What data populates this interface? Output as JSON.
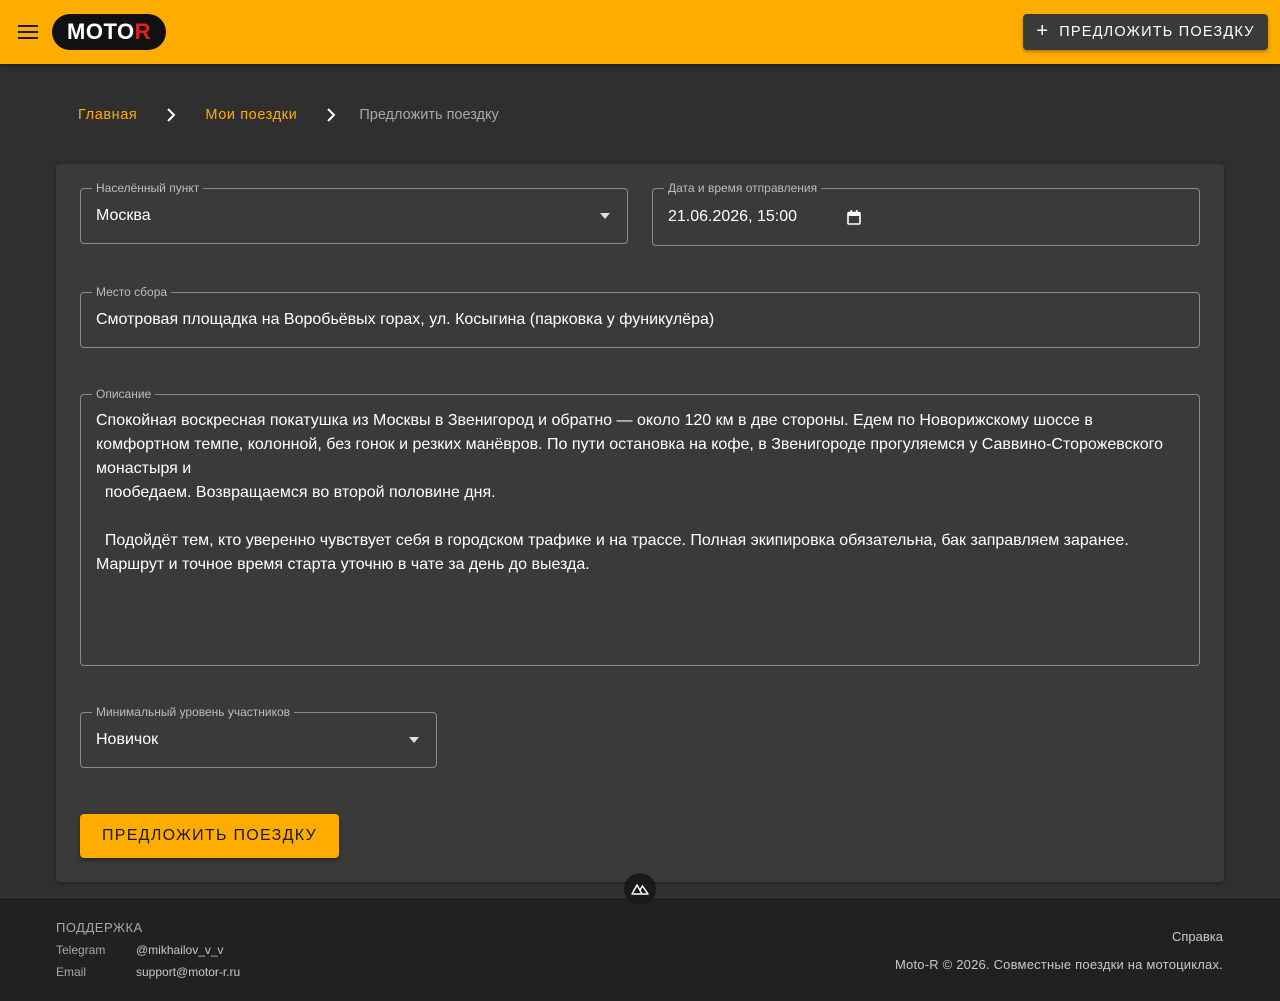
{
  "header": {
    "logo_main": "MOTO",
    "logo_accent": "R",
    "cta_label": "Предложить поездку"
  },
  "breadcrumb": {
    "items": [
      "Главная",
      "Мои поездки"
    ],
    "current": "Предложить поездку"
  },
  "form": {
    "city": {
      "label": "Населённый пункт",
      "value": "Москва"
    },
    "datetime": {
      "label": "Дата и время отправления",
      "value": "21.06.2026, 15:00"
    },
    "meeting_point": {
      "label": "Место сбора",
      "value": "Смотровая площадка на Воробьёвых горах, ул. Косыгина (парковка у фуникулёра)"
    },
    "description": {
      "label": "Описание",
      "value": "Спокойная воскресная покатушка из Москвы в Звенигород и обратно — около 120 км в две стороны. Едем по Новорижскому шоссе в комфортном темпе, колонной, без гонок и резких манёвров. По пути остановка на кофе, в Звенигороде прогуляемся у Саввино-Сторожевского монастыря и\n  пообедаем. Возвращаемся во второй половине дня.\n\n  Подойдёт тем, кто уверенно чувствует себя в городском трафике и на трассе. Полная экипировка обязательна, бак заправляем заранее. Маршрут и точное время старта уточню в чате за день до выезда."
    },
    "level": {
      "label": "Минимальный уровень участников",
      "value": "Новичок"
    },
    "submit_label": "Предложить поездку"
  },
  "footer": {
    "support_title": "ПОДДЕРЖКА",
    "contacts": [
      {
        "key": "Telegram",
        "value": "@mikhailov_v_v"
      },
      {
        "key": "Email",
        "value": "support@motor-r.ru"
      }
    ],
    "help_link": "Справка",
    "copyright": "Moto-R © 2026. Совместные поездки на мотоциклах."
  },
  "colors": {
    "accent": "#ffac00",
    "background": "#2f2f2f",
    "card": "#3a3a3a",
    "footer": "#212121"
  },
  "icons": [
    "menu-icon",
    "plus-icon",
    "chevron-right-icon",
    "dropdown-arrow-icon",
    "calendar-icon",
    "nuxt-icon"
  ]
}
